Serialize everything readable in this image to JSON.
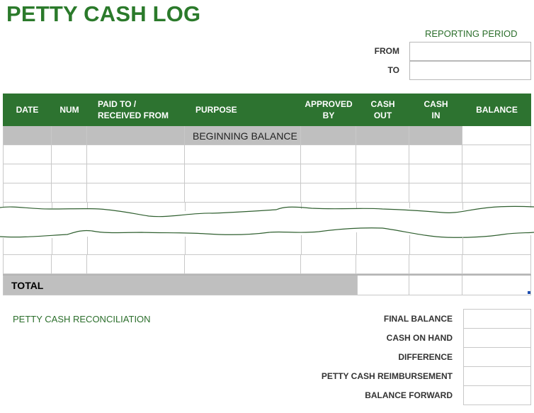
{
  "title": "PETTY CASH LOG",
  "reporting_period": {
    "label": "REPORTING PERIOD",
    "from_label": "FROM",
    "to_label": "TO",
    "from_value": "",
    "to_value": ""
  },
  "table": {
    "headers": [
      {
        "line1": "DATE",
        "line2": ""
      },
      {
        "line1": "NUM",
        "line2": ""
      },
      {
        "line1": "PAID TO /",
        "line2": "RECEIVED FROM"
      },
      {
        "line1": "PURPOSE",
        "line2": ""
      },
      {
        "line1": "APPROVED",
        "line2": "BY"
      },
      {
        "line1": "CASH",
        "line2": "OUT"
      },
      {
        "line1": "CASH",
        "line2": "IN"
      },
      {
        "line1": "BALANCE",
        "line2": ""
      }
    ],
    "beginning_balance_label": "BEGINNING BALANCE",
    "total_label": "TOTAL"
  },
  "reconciliation": {
    "title": "PETTY CASH RECONCILIATION",
    "items": [
      {
        "label": "FINAL BALANCE",
        "value": ""
      },
      {
        "label": "CASH ON HAND",
        "value": ""
      },
      {
        "label": "DIFFERENCE",
        "value": ""
      },
      {
        "label": "PETTY CASH REIMBURSEMENT",
        "value": ""
      },
      {
        "label": "BALANCE FORWARD",
        "value": ""
      }
    ]
  },
  "colors": {
    "title": "#2b7a2b",
    "header_bg": "#2d7330",
    "header_text": "#ffffff",
    "shaded_cell": "#bfbfbf",
    "tear_line": "#2f5f2f"
  }
}
